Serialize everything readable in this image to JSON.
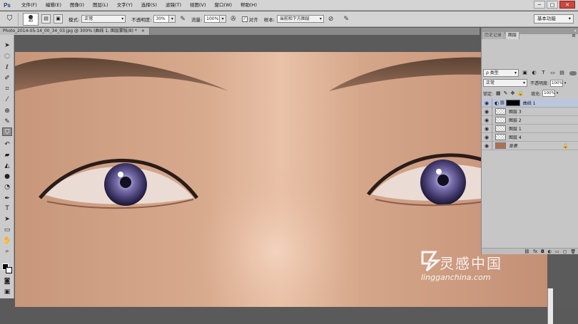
{
  "app": {
    "logo": "Ps"
  },
  "menu": [
    "文件(F)",
    "编辑(E)",
    "图像(I)",
    "图层(L)",
    "文字(Y)",
    "选择(S)",
    "滤镜(T)",
    "视图(V)",
    "窗口(W)",
    "帮助(H)"
  ],
  "window_controls": {
    "minimize": "─",
    "restore": "□",
    "close": "✕"
  },
  "options": {
    "brush_size": "40",
    "mode_label": "模式:",
    "mode_value": "正常",
    "opacity_label": "不透明度:",
    "opacity_value": "30%",
    "flow_label": "流量:",
    "flow_value": "100%",
    "aligned_label": "对齐",
    "aligned_checked": true,
    "sample_label": "样本:",
    "sample_value": "当前和下方图层",
    "workspace": "基本功能"
  },
  "document": {
    "tab_title": "Photo_2014-05-14_00_34_03.jpg @ 300% (曲线 1, 图层蒙版/8) *",
    "tab_close": "×"
  },
  "toolbar": {
    "tools": [
      "move-tool",
      "marquee-tool",
      "lasso-tool",
      "quick-select-tool",
      "crop-tool",
      "eyedropper-tool",
      "spot-healing-tool",
      "brush-tool",
      "clone-stamp-tool",
      "history-brush-tool",
      "eraser-tool",
      "gradient-tool",
      "blur-tool",
      "dodge-tool",
      "pen-tool",
      "type-tool",
      "path-select-tool",
      "rectangle-tool",
      "hand-tool",
      "zoom-tool"
    ],
    "active_tool": "clone-stamp-tool",
    "foreground_color": "#000000",
    "background_color": "#ffffff"
  },
  "panel": {
    "tabs": [
      "历史记录",
      "图层"
    ],
    "active_tab": "图层",
    "filter_kind": "ρ 类型",
    "blend_mode": "正常",
    "opacity_label": "不透明度:",
    "opacity_value": "100%",
    "lock_label": "锁定:",
    "fill_label": "填充:",
    "fill_value": "100%",
    "layers": [
      {
        "name": "曲线 1",
        "type": "adjustment",
        "selected": true
      },
      {
        "name": "图层 3",
        "type": "pixel",
        "selected": false
      },
      {
        "name": "图层 2",
        "type": "pixel",
        "selected": false
      },
      {
        "name": "图层 1",
        "type": "pixel",
        "selected": false
      },
      {
        "name": "图层 4",
        "type": "pixel",
        "selected": false
      },
      {
        "name": "背景",
        "type": "background",
        "selected": false,
        "locked": true
      }
    ],
    "footer_icons": [
      "link-icon",
      "fx-icon",
      "mask-icon",
      "adjustment-icon",
      "group-icon",
      "new-layer-icon",
      "trash-icon"
    ]
  },
  "watermark": {
    "cn": "灵感中国",
    "en": "lingganchina.com"
  },
  "colors": {
    "menubar": "#d4d4d4",
    "panel": "#c6c6c6",
    "selected_layer": "#b9c6de",
    "skin": "#c8977a"
  }
}
